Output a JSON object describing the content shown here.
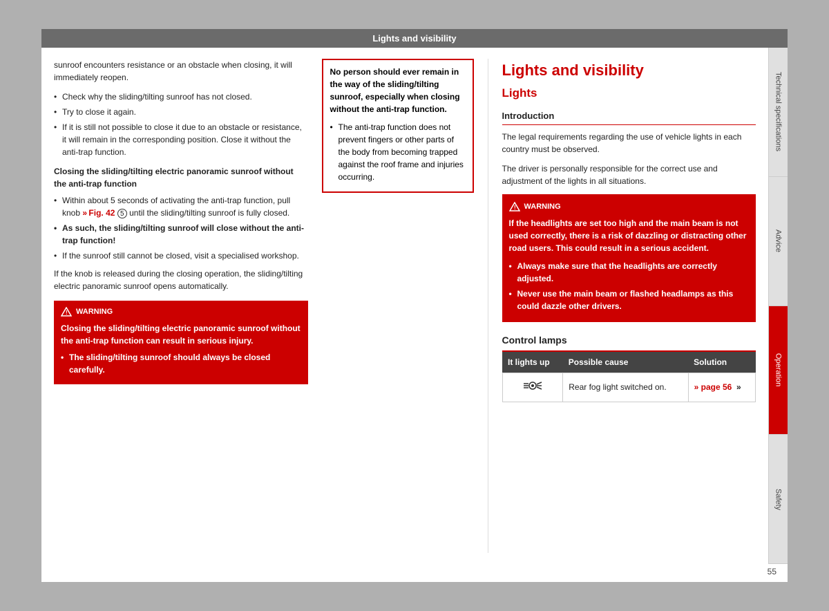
{
  "header": {
    "title": "Lights and visibility"
  },
  "left_column": {
    "intro_text": "sunroof encounters resistance or an obstacle when closing, it will immediately reopen.",
    "bullets_1": [
      "Check why the sliding/tilting sunroof has not closed.",
      "Try to close it again.",
      "If it is still not possible to close it due to an obstacle or resistance, it will remain in the corresponding position. Close it without the anti-trap function."
    ],
    "closing_heading": "Closing the sliding/tilting electric panoramic sunroof without the anti-trap function",
    "closing_bullets": [
      "Within about 5 seconds of activating the anti-trap function, pull knob",
      "As such, the sliding/tilting sunroof will close without the anti-trap function!",
      "If the sunroof still cannot be closed, visit a specialised workshop."
    ],
    "closing_ref": "Fig. 42",
    "closing_ref_num": "5",
    "closing_mid_text": "un-til the sliding/tilting sunroof is fully closed.",
    "knob_text": "If the knob is released during the closing operation, the sliding/tilting electric panoramic sunroof opens automatically.",
    "warning_bottom": {
      "header": "WARNING",
      "bold_text": "Closing the sliding/tilting electric panoramic sunroof without the anti-trap function can result in serious injury.",
      "bullet": "The sliding/tilting sunroof should always be closed carefully."
    }
  },
  "center_column": {
    "warning_box": {
      "bold_text": "No person should ever remain in the way of the sliding/tilting sunroof, especially when closing without the anti-trap function.",
      "bullet": "The anti-trap function does not prevent fingers or other parts of the body from becoming trapped against the roof frame and injuries occurring."
    }
  },
  "right_column": {
    "section_title": "Lights and visibility",
    "subsection_title": "Lights",
    "introduction": {
      "heading": "Introduction",
      "para1": "The legal requirements regarding the use of vehicle lights in each country must be observed.",
      "para2": "The driver is personally responsible for the correct use and adjustment of the lights in all situations."
    },
    "warning": {
      "header": "WARNING",
      "main_text": "If the headlights are set too high and the main beam is not used correctly, there is a risk of dazzling or distracting other road users. This could result in a serious accident.",
      "bullet1": "Always make sure that the headlights are correctly adjusted.",
      "bullet2": "Never use the main beam or flashed headlamps as this could dazzle other drivers."
    },
    "control_lamps": {
      "title": "Control lamps",
      "table": {
        "headers": [
          "It lights up",
          "Possible cause",
          "Solution"
        ],
        "rows": [
          {
            "icon": "fog-rear-icon",
            "possible_cause": "Rear fog light switched on.",
            "solution": "» page 56",
            "arrow": "»"
          }
        ]
      }
    }
  },
  "sidebar": {
    "tabs": [
      {
        "label": "Technical specifications",
        "active": false
      },
      {
        "label": "Advice",
        "active": false
      },
      {
        "label": "Operation",
        "active": true
      },
      {
        "label": "Safety",
        "active": false
      }
    ]
  },
  "page_number": "55"
}
